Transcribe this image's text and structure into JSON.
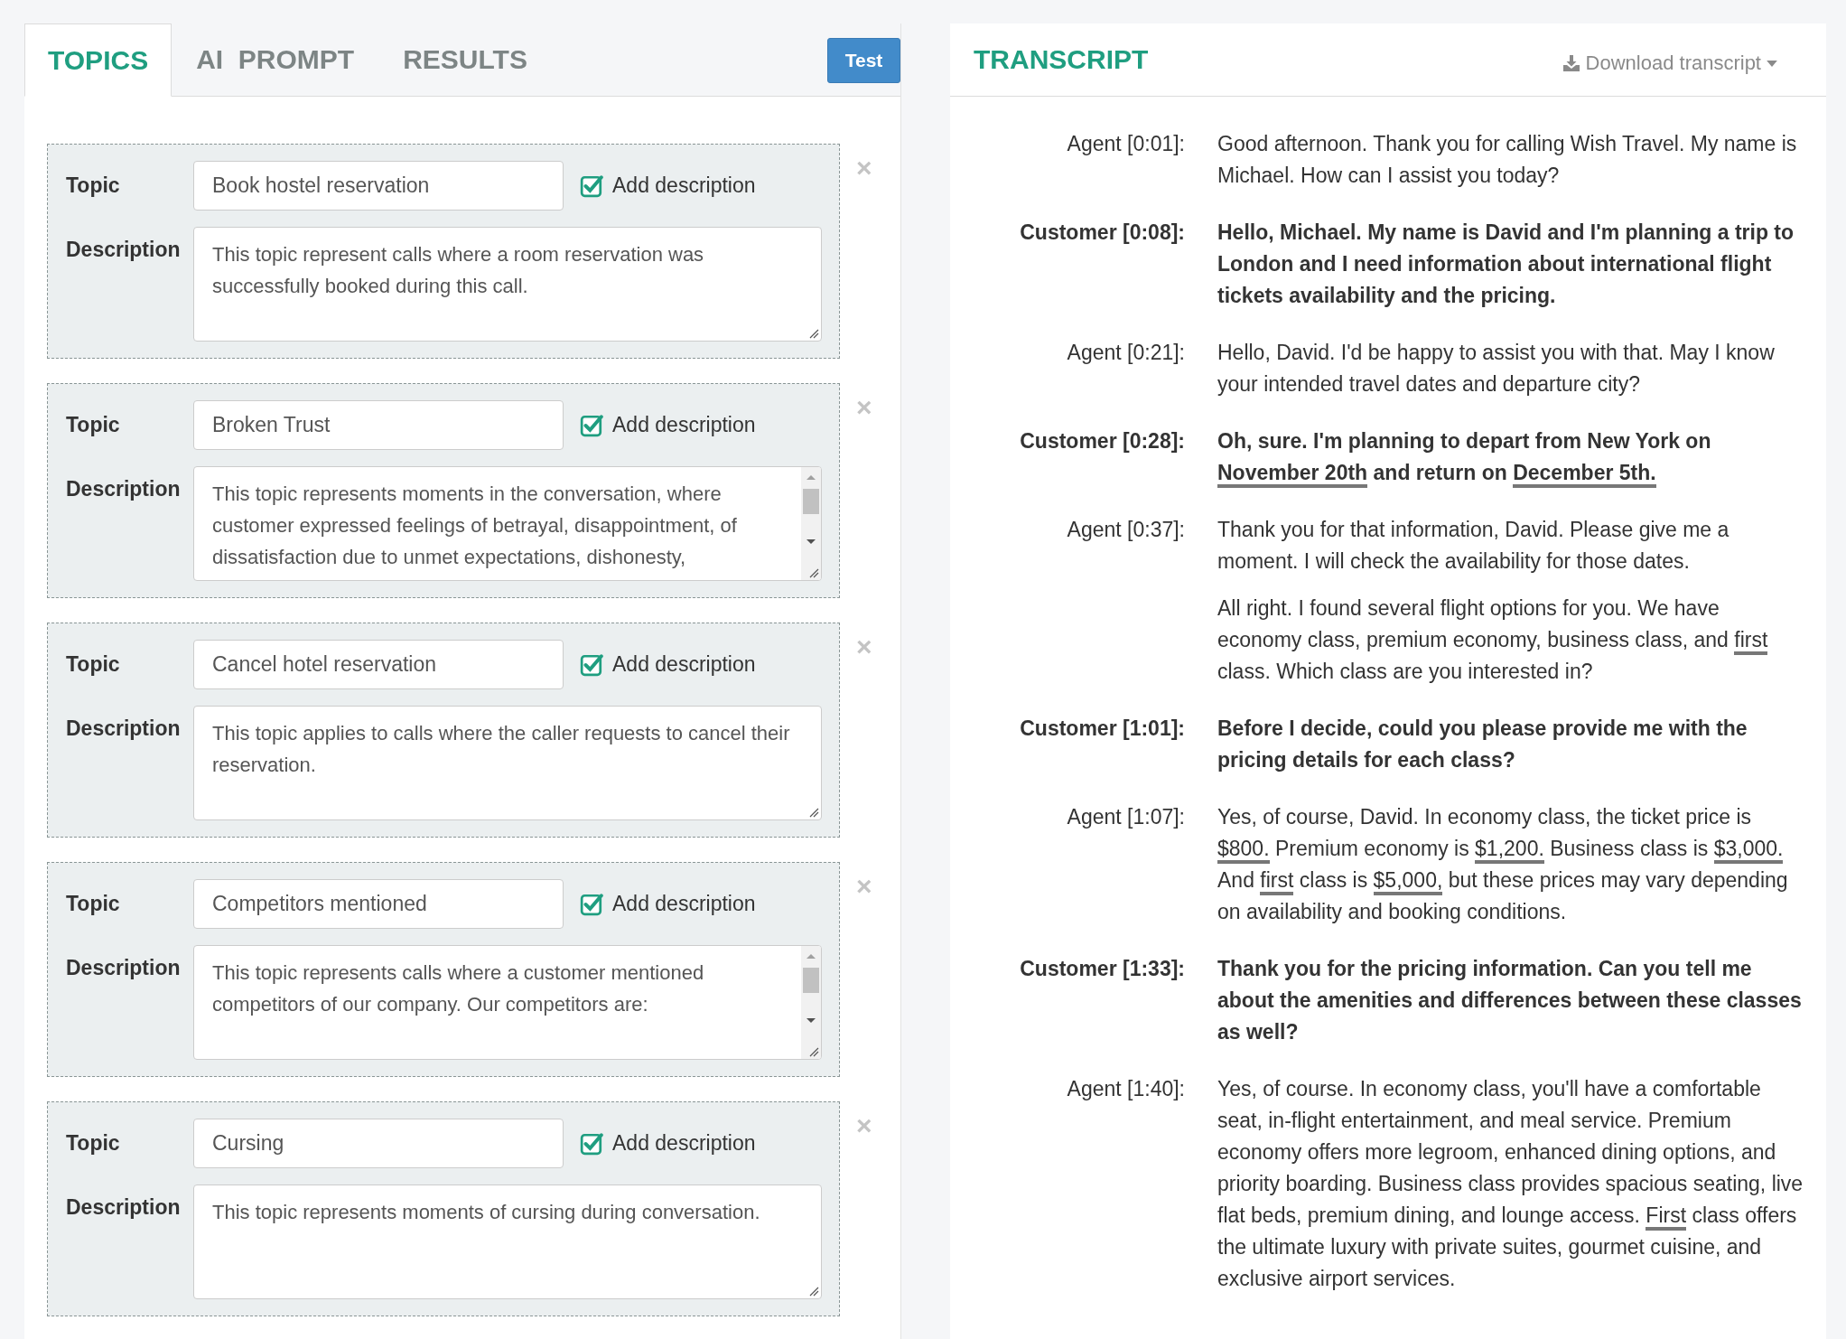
{
  "tabs": [
    {
      "label": "TOPICS",
      "selected": true
    },
    {
      "label": "AI  PROMPT",
      "selected": false
    },
    {
      "label": "RESULTS",
      "selected": false
    }
  ],
  "test_button": "Test",
  "close_glyph": "×",
  "topics": [
    {
      "topic_label": "Topic",
      "description_label": "Description",
      "name": "Book hostel reservation",
      "add_description": {
        "label": "Add description",
        "checked": true
      },
      "description": "This topic represent calls where a room reservation was successfully booked during this call.",
      "scrollable": false
    },
    {
      "topic_label": "Topic",
      "description_label": "Description",
      "name": "Broken Trust",
      "add_description": {
        "label": "Add description",
        "checked": true
      },
      "description": "This topic represents moments in the conversation, where customer expressed feelings of betrayal, disappointment, of dissatisfaction due to unmet expectations, dishonesty,",
      "scrollable": true
    },
    {
      "topic_label": "Topic",
      "description_label": "Description",
      "name": "Cancel hotel reservation",
      "add_description": {
        "label": "Add description",
        "checked": true
      },
      "description": "This topic applies to calls where the caller requests to cancel their reservation.",
      "scrollable": false
    },
    {
      "topic_label": "Topic",
      "description_label": "Description",
      "name": "Competitors mentioned",
      "add_description": {
        "label": "Add description",
        "checked": true
      },
      "description": "This topic represents calls where a customer mentioned competitors of our company. Our competitors are:",
      "scrollable": true
    },
    {
      "topic_label": "Topic",
      "description_label": "Description",
      "name": "Cursing",
      "add_description": {
        "label": "Add description",
        "checked": true
      },
      "description": "This topic represents moments of cursing during conversation.",
      "scrollable": false
    }
  ],
  "transcript": {
    "title": "TRANSCRIPT",
    "download": "Download transcript",
    "entries": [
      {
        "speaker": "Agent [0:01]:",
        "kind": "agent",
        "paragraphs": [
          [
            {
              "text": "Good afternoon. Thank you for calling Wish Travel. My name is Michael. How can I assist you today?",
              "highlight": false
            }
          ]
        ]
      },
      {
        "speaker": "Customer [0:08]:",
        "kind": "customer",
        "paragraphs": [
          [
            {
              "text": "Hello, Michael. My name is David and I'm planning a trip to London and I need information about international flight tickets availability and the pricing.",
              "highlight": false
            }
          ]
        ]
      },
      {
        "speaker": "Agent [0:21]:",
        "kind": "agent",
        "paragraphs": [
          [
            {
              "text": "Hello, David. I'd be happy to assist you with that. May I know your intended travel dates and departure city?",
              "highlight": false
            }
          ]
        ]
      },
      {
        "speaker": "Customer [0:28]:",
        "kind": "customer",
        "paragraphs": [
          [
            {
              "text": "Oh, sure. I'm planning to depart from New York on ",
              "highlight": false
            },
            {
              "text": "November 20th",
              "highlight": true
            },
            {
              "text": " and return on ",
              "highlight": false
            },
            {
              "text": "December 5th.",
              "highlight": true
            }
          ]
        ]
      },
      {
        "speaker": "Agent [0:37]:",
        "kind": "agent",
        "paragraphs": [
          [
            {
              "text": "Thank you for that information, David. Please give me a moment. I will check the availability for those dates.",
              "highlight": false
            }
          ],
          [
            {
              "text": "All right. I found several flight options for you. We have economy class, premium economy, business class, and ",
              "highlight": false
            },
            {
              "text": "first",
              "highlight": true
            },
            {
              "text": " class. Which class are you interested in?",
              "highlight": false
            }
          ]
        ]
      },
      {
        "speaker": "Customer [1:01]:",
        "kind": "customer",
        "paragraphs": [
          [
            {
              "text": "Before I decide, could you please provide me with the pricing details for each class?",
              "highlight": false
            }
          ]
        ]
      },
      {
        "speaker": "Agent [1:07]:",
        "kind": "agent",
        "paragraphs": [
          [
            {
              "text": "Yes, of course, David. In economy class, the ticket price is ",
              "highlight": false
            },
            {
              "text": "$800.",
              "highlight": true
            },
            {
              "text": " Premium economy is ",
              "highlight": false
            },
            {
              "text": "$1,200.",
              "highlight": true
            },
            {
              "text": " Business class is ",
              "highlight": false
            },
            {
              "text": "$3,000.",
              "highlight": true
            },
            {
              "text": " And ",
              "highlight": false
            },
            {
              "text": "first",
              "highlight": true
            },
            {
              "text": " class is ",
              "highlight": false
            },
            {
              "text": "$5,000,",
              "highlight": true
            },
            {
              "text": " but these prices may vary depending on availability and booking conditions.",
              "highlight": false
            }
          ]
        ]
      },
      {
        "speaker": "Customer [1:33]:",
        "kind": "customer",
        "paragraphs": [
          [
            {
              "text": "Thank you for the pricing information. Can you tell me about the amenities and differences between these classes as well?",
              "highlight": false
            }
          ]
        ]
      },
      {
        "speaker": "Agent [1:40]:",
        "kind": "agent",
        "paragraphs": [
          [
            {
              "text": "Yes, of course. In economy class, you'll have a comfortable seat, in-flight entertainment, and meal service. Premium economy offers more legroom, enhanced dining options, and priority boarding. Business class provides spacious seating, live flat beds, premium dining, and lounge access. ",
              "highlight": false
            },
            {
              "text": "First",
              "highlight": true
            },
            {
              "text": " class offers the ultimate luxury with private suites, gourmet cuisine, and exclusive airport services.",
              "highlight": false
            }
          ]
        ]
      }
    ]
  }
}
